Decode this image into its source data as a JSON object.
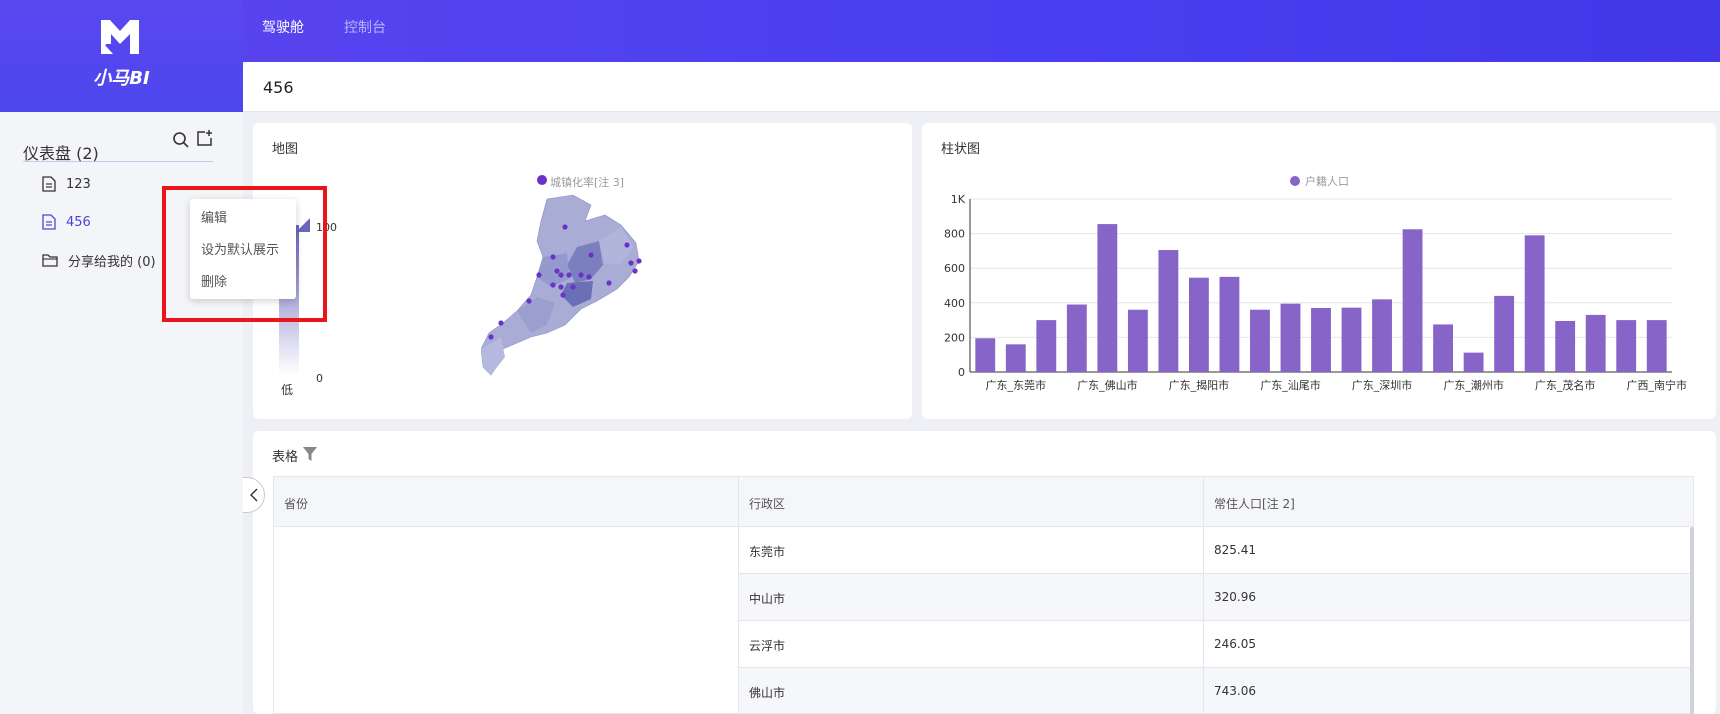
{
  "app": {
    "logo_text": "小马BI"
  },
  "header": {
    "tabs": [
      {
        "label": "驾驶舱",
        "active": true
      },
      {
        "label": "控制台",
        "active": false
      }
    ]
  },
  "sidebar": {
    "title": "仪表盘 (2)",
    "items": [
      {
        "label": "123",
        "icon": "document-icon",
        "active": false
      },
      {
        "label": "456",
        "icon": "document-icon",
        "active": true
      },
      {
        "label": "分享给我的 (0)",
        "icon": "folder-icon",
        "active": false
      }
    ]
  },
  "context_menu": {
    "items": [
      "编辑",
      "设为默认展示",
      "删除"
    ]
  },
  "page": {
    "title": "456"
  },
  "map_card": {
    "title": "地图",
    "legend_label": "城镇化率[注 3]",
    "scale_max": "100",
    "scale_min": "0",
    "scale_low_label": "低"
  },
  "chart_data": {
    "type": "bar",
    "title": "柱状图",
    "series": [
      {
        "name": "户籍人口",
        "values": [
          195,
          160,
          300,
          390,
          855,
          360,
          705,
          545,
          550,
          360,
          395,
          370,
          372,
          420,
          825,
          275,
          112,
          440,
          790,
          295,
          330,
          300,
          300
        ]
      }
    ],
    "tick_labels": [
      "广东_东莞市",
      "广东_佛山市",
      "广东_揭阳市",
      "广东_汕尾市",
      "广东_深圳市",
      "广东_潮州市",
      "广东_茂名市",
      "广西_南宁市"
    ],
    "tick_label_every": 3,
    "yticks": [
      "0",
      "200",
      "400",
      "600",
      "800",
      "1K"
    ],
    "ylim": [
      0,
      1000
    ],
    "grid": true,
    "legend": "top-center",
    "color": "#8764c8"
  },
  "table_card": {
    "title": "表格",
    "columns": [
      "省份",
      "行政区",
      "常住人口[注 2]"
    ],
    "rows": [
      {
        "district": "东莞市",
        "population": "825.41"
      },
      {
        "district": "中山市",
        "population": "320.96"
      },
      {
        "district": "云浮市",
        "population": "246.05"
      },
      {
        "district": "佛山市",
        "population": "743.06"
      }
    ]
  },
  "colors": {
    "accent": "#4a3ff0",
    "bar": "#8764c8",
    "highlight": "#e9151b"
  }
}
